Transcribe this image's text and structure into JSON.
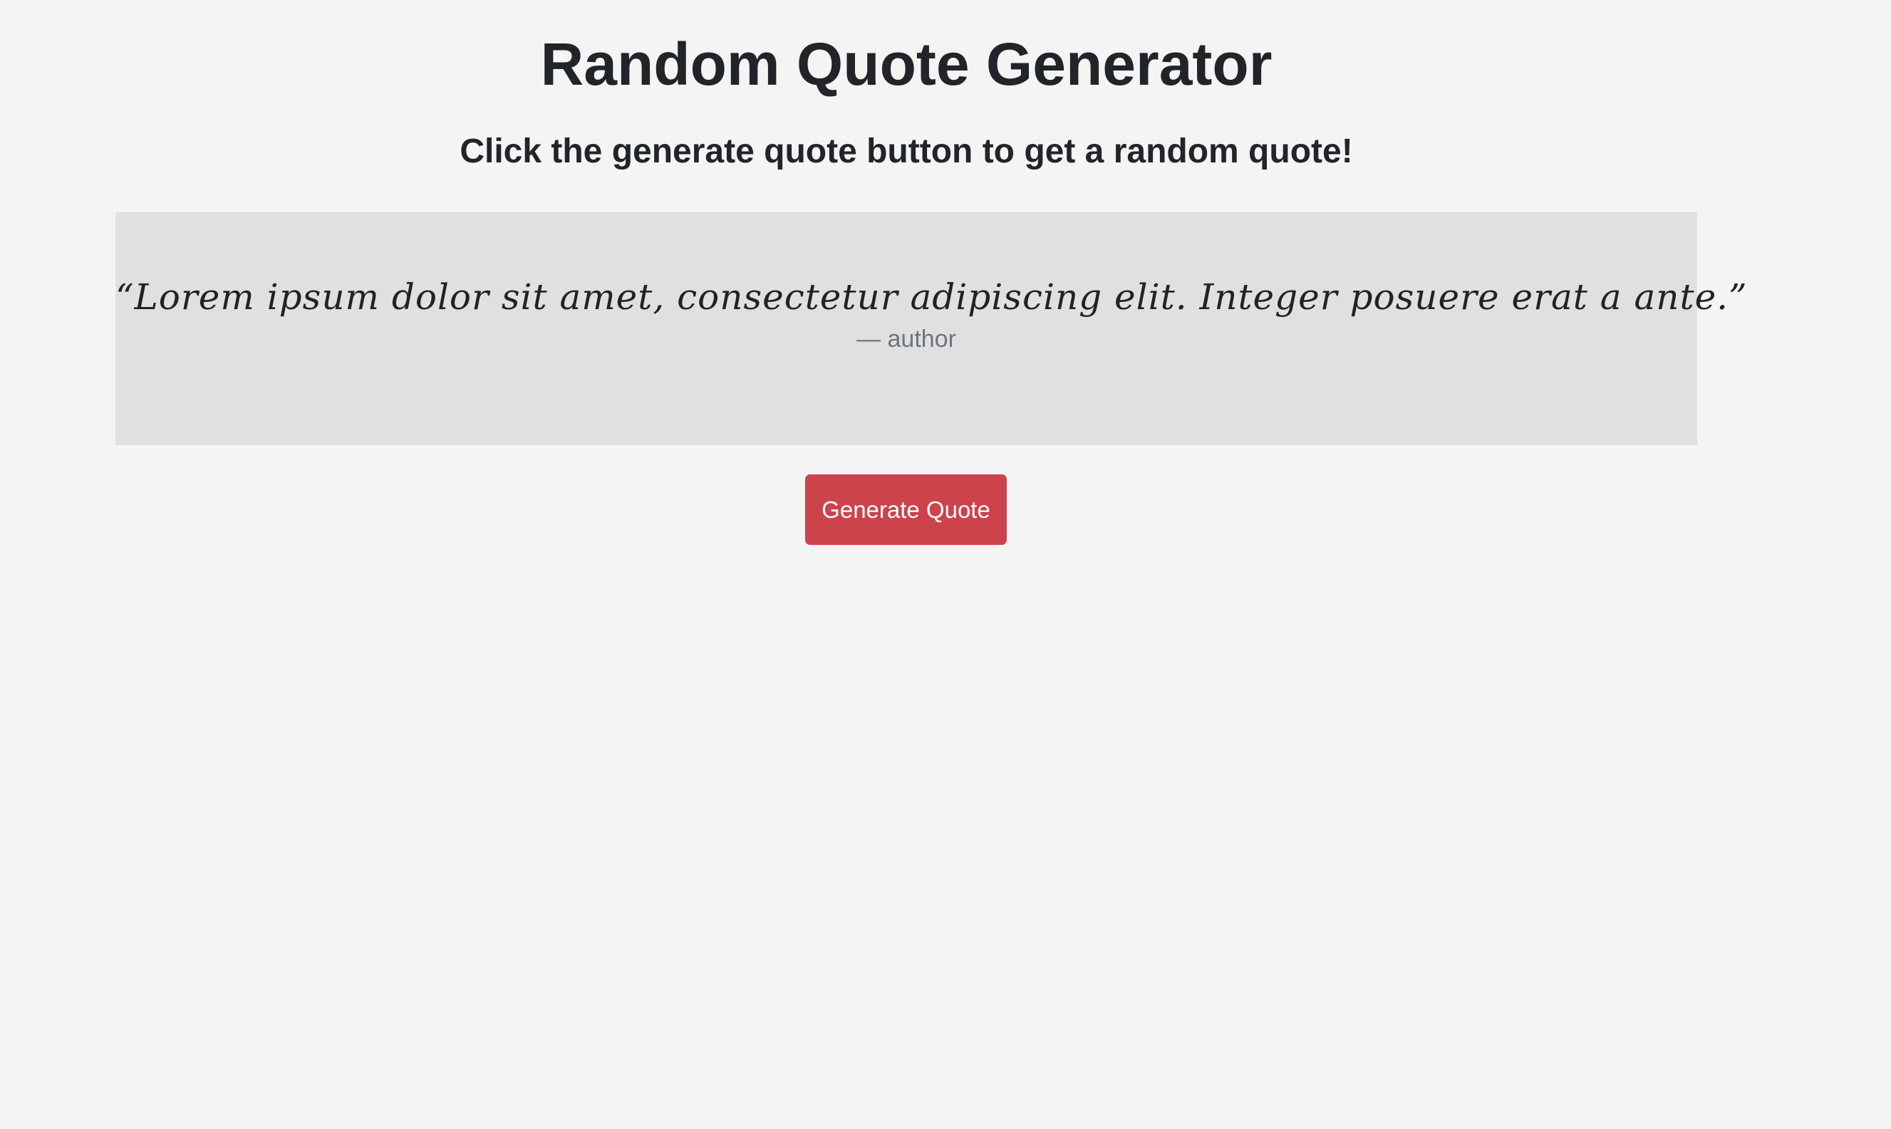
{
  "header": {
    "title": "Random Quote Generator",
    "subtitle": "Click the generate quote button to get a random quote!"
  },
  "quote": {
    "text": "“Lorem ipsum dolor sit amet, consectetur adipiscing elit. Integer posuere erat a ante.”",
    "author": "— author"
  },
  "actions": {
    "generate_label": "Generate Quote"
  },
  "colors": {
    "background": "#f4f4f4",
    "quote_box": "#e0e0e0",
    "button": "#cc434b",
    "author_text": "#6c757d"
  }
}
